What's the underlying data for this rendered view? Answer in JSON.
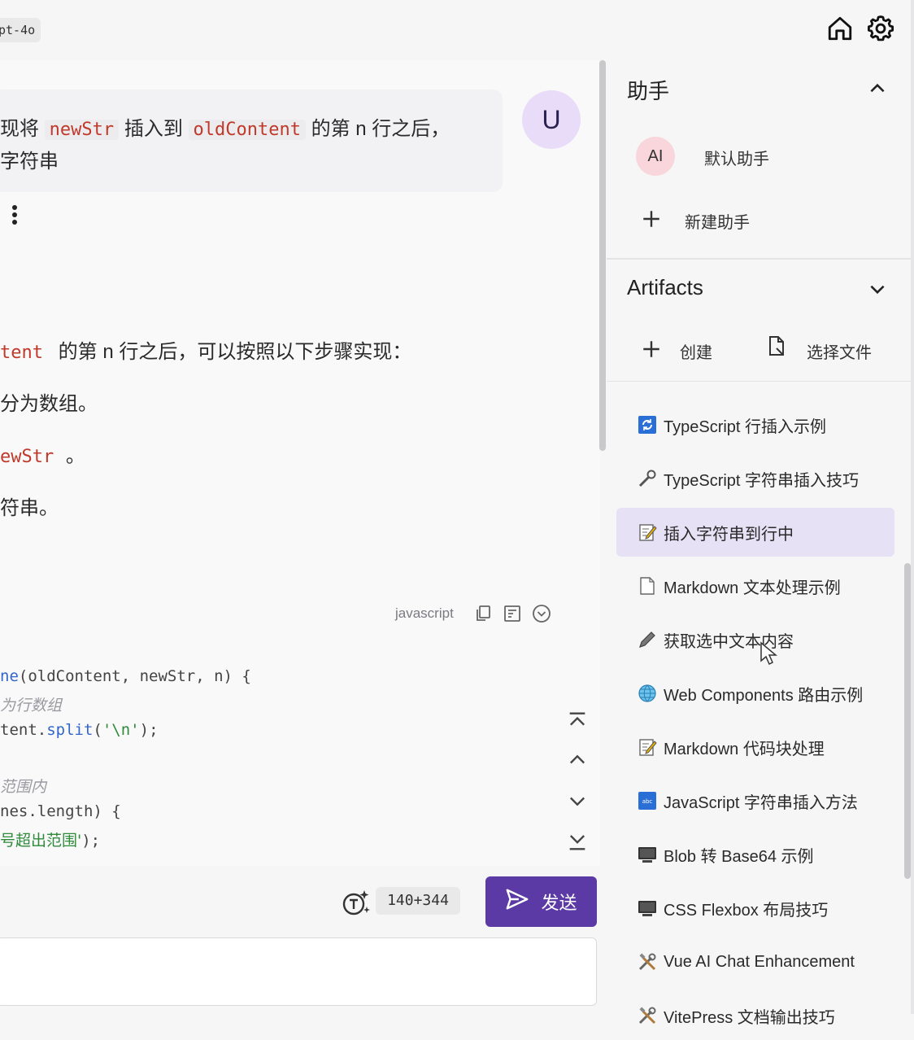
{
  "topbar": {
    "model_label": "pt-4o",
    "home_icon": "home-icon",
    "settings_icon": "gear-icon"
  },
  "chat": {
    "user_avatar": "U",
    "user_message": {
      "line1_pre": "现将",
      "line1_code1": "newStr",
      "line1_mid": "插入到",
      "line1_code2": "oldContent",
      "line1_post": "的第 n 行之后，",
      "line2": "字符串"
    },
    "answer": {
      "line1_code": "tent",
      "line1_text": "的第 n 行之后，可以按照以下步骤实现：",
      "line2": "分为数组。",
      "line3_code": "ewStr",
      "line3_text": "。",
      "line4": "符串。"
    },
    "code_block": {
      "language": "javascript",
      "lines": {
        "l1_fn": "ne",
        "l1_rest": "(oldContent, newStr, n) {",
        "l2_comment": "为行数组",
        "l3_pre": "tent.",
        "l3_fn": "split",
        "l3_open": "(",
        "l3_str": "'\\n'",
        "l3_close": ");",
        "l4_comment": "范围内",
        "l5": "nes.length) {",
        "l6_str": "号超出范围'",
        "l6_close": ");"
      }
    }
  },
  "input": {
    "token_count": "140+344",
    "send_label": "发送"
  },
  "sidebar": {
    "assistants": {
      "title": "助手",
      "items": [
        {
          "avatar": "AI",
          "label": "默认助手"
        }
      ],
      "new_label": "新建助手"
    },
    "artifacts": {
      "title": "Artifacts",
      "create_label": "创建",
      "select_file_label": "选择文件",
      "items": [
        {
          "label": "TypeScript 行插入示例",
          "icon": "refresh-blue-icon"
        },
        {
          "label": "TypeScript 字符串插入技巧",
          "icon": "wrench-icon"
        },
        {
          "label": "插入字符串到行中",
          "icon": "memo-icon"
        },
        {
          "label": "Markdown 文本处理示例",
          "icon": "page-icon"
        },
        {
          "label": "获取选中文本内容",
          "icon": "pen-icon"
        },
        {
          "label": "Web Components 路由示例",
          "icon": "globe-icon"
        },
        {
          "label": "Markdown 代码块处理",
          "icon": "memo-icon"
        },
        {
          "label": "JavaScript 字符串插入方法",
          "icon": "abc-icon"
        },
        {
          "label": "Blob 转 Base64 示例",
          "icon": "monitor-icon"
        },
        {
          "label": "CSS Flexbox 布局技巧",
          "icon": "monitor-icon"
        },
        {
          "label": "Vue AI Chat Enhancement",
          "icon": "tools-icon"
        },
        {
          "label": "VitePress 文档输出技巧",
          "icon": "tools-icon"
        }
      ],
      "selected_index": 2
    }
  },
  "colors": {
    "accent": "#5b3aa6",
    "user_avatar_bg": "#e8dcf8",
    "ai_avatar_bg": "#f9d6dc",
    "selected_bg": "#e6e1f5",
    "code_red": "#c0392b"
  }
}
